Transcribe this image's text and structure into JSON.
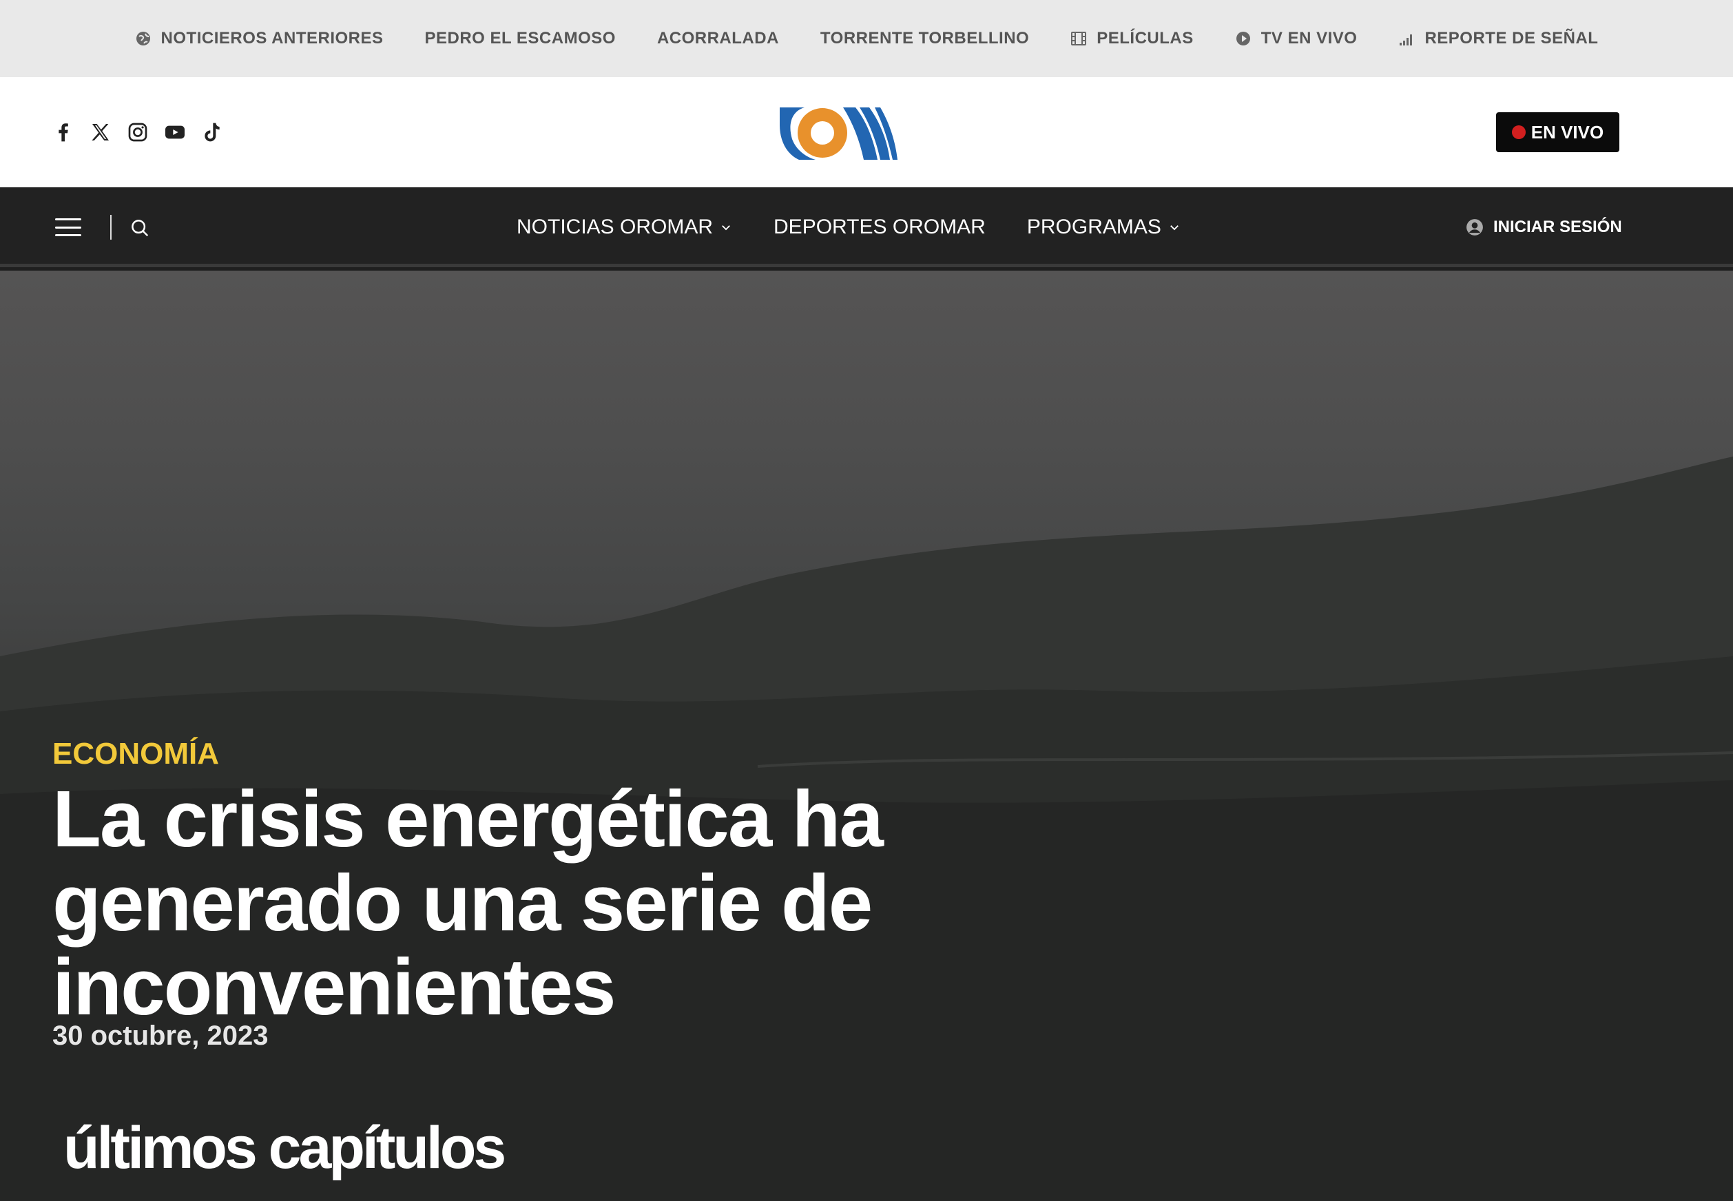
{
  "topbar": {
    "links": [
      {
        "label": "NOTICIEROS ANTERIORES",
        "icon": "globe-icon"
      },
      {
        "label": "PEDRO EL ESCAMOSO",
        "icon": null
      },
      {
        "label": "ACORRALADA",
        "icon": null
      },
      {
        "label": "TORRENTE TORBELLINO",
        "icon": null
      },
      {
        "label": "PELÍCULAS",
        "icon": "film-icon"
      },
      {
        "label": "TV EN VIVO",
        "icon": "play-circle-icon"
      },
      {
        "label": "REPORTE DE SEÑAL",
        "icon": "signal-icon"
      }
    ]
  },
  "header": {
    "social_icons": [
      "facebook-icon",
      "x-icon",
      "instagram-icon",
      "youtube-icon",
      "tiktok-icon"
    ],
    "live_button_label": "EN VIVO",
    "live_dot_color": "#d21f1f",
    "logo_colors": {
      "orange": "#e8912c",
      "blue": "#2266b2"
    }
  },
  "nav": {
    "items": [
      {
        "label": "NOTICIAS OROMAR",
        "dropdown": true
      },
      {
        "label": "DEPORTES OROMAR",
        "dropdown": false
      },
      {
        "label": "PROGRAMAS",
        "dropdown": true
      }
    ],
    "login_label": "INICIAR SESIÓN"
  },
  "hero": {
    "category": "ECONOMÍA",
    "category_color": "#f2c93a",
    "headline": "La crisis energética ha generado una serie de inconvenientes",
    "date": "30 octubre, 2023"
  },
  "section": {
    "title": "últimos capítulos"
  }
}
